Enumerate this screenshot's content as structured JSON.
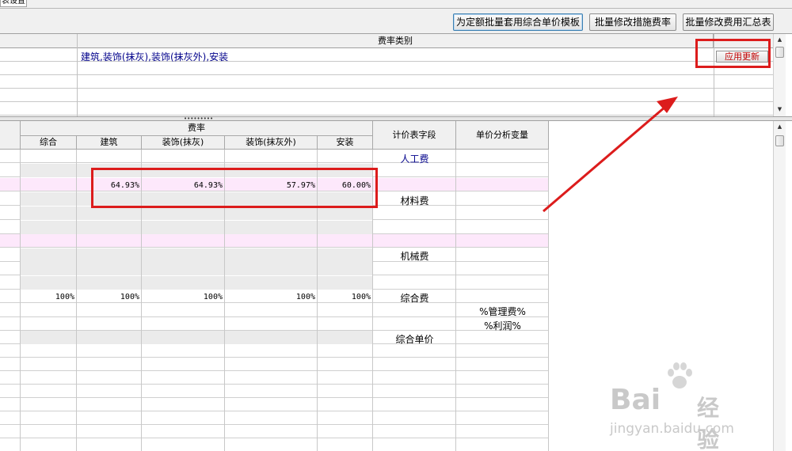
{
  "tab": {
    "fragment": "表设置"
  },
  "toolbar": {
    "btn_template": "为定额批量套用综合单价模板",
    "btn_measure": "批量修改措施费率",
    "btn_summary": "批量修改费用汇总表"
  },
  "upper_grid": {
    "header": "费率类别",
    "fee_categories": "建筑,装饰(抹灰),装饰(抹灰外),安装",
    "apply_button": "应用更新"
  },
  "lower_grid": {
    "header_group": "费率",
    "columns": [
      "综合",
      "建筑",
      "装饰(抹灰)",
      "装饰(抹灰外)",
      "安装"
    ],
    "col_field": "计价表字段",
    "col_var": "单价分析变量",
    "rate_values": [
      "64.93%",
      "64.93%",
      "57.97%",
      "60.00%"
    ],
    "hundred_values": [
      "100%",
      "100%",
      "100%",
      "100%",
      "100%"
    ],
    "fields": {
      "labor": "人工费",
      "material": "材料费",
      "machine": "机械费",
      "overhead": "综合费",
      "unit_price": "综合单价"
    },
    "vars": {
      "mgmt": "%管理费%",
      "profit": "%利润%"
    }
  },
  "watermark": {
    "brand": "Bai",
    "brand_tail": "经验",
    "url": "jingyan.baidu.com"
  },
  "colors": {
    "annotation_red": "#dc1c1c",
    "link_blue": "#00008b",
    "pink_row": "#fde8fb"
  }
}
